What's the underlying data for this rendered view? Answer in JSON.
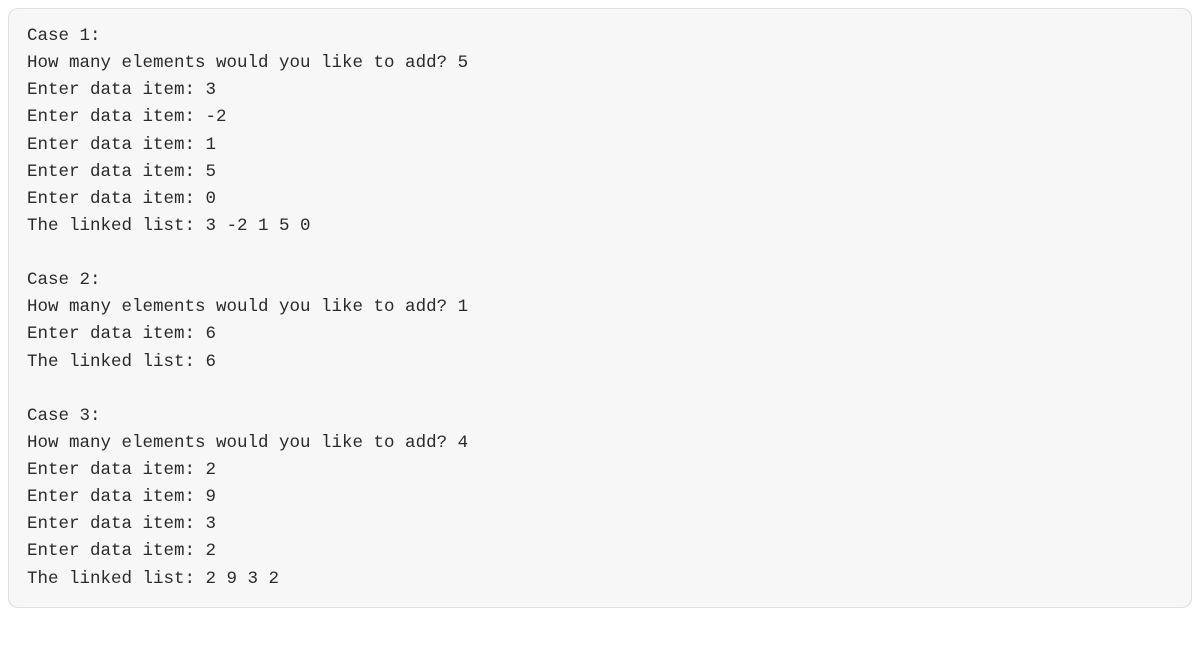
{
  "cases": [
    {
      "header": "Case 1:",
      "prompt": "How many elements would you like to add? 5",
      "entries": [
        "Enter data item: 3",
        "Enter data item: -2",
        "Enter data item: 1",
        "Enter data item: 5",
        "Enter data item: 0"
      ],
      "result": "The linked list: 3 -2 1 5 0"
    },
    {
      "header": "Case 2:",
      "prompt": "How many elements would you like to add? 1",
      "entries": [
        "Enter data item: 6"
      ],
      "result": "The linked list: 6"
    },
    {
      "header": "Case 3:",
      "prompt": "How many elements would you like to add? 4",
      "entries": [
        "Enter data item: 2",
        "Enter data item: 9",
        "Enter data item: 3",
        "Enter data item: 2"
      ],
      "result": "The linked list: 2 9 3 2"
    }
  ]
}
